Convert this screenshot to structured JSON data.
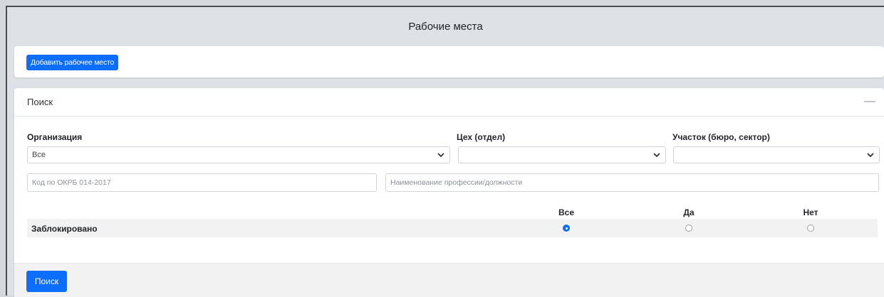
{
  "page": {
    "title": "Рабочие места"
  },
  "actions": {
    "add_button": "Добавить рабочее место"
  },
  "search": {
    "title": "Поиск",
    "collapse_icon": "minus-icon",
    "fields": {
      "organization": {
        "label": "Организация",
        "value": "Все"
      },
      "workshop": {
        "label": "Цех (отдел)",
        "value": ""
      },
      "section": {
        "label": "Участок (бюро, сектор)",
        "value": ""
      },
      "okrb_code": {
        "placeholder": "Код по ОКРБ 014-2017",
        "value": ""
      },
      "profession": {
        "placeholder": "Наименование профессии/должности",
        "value": ""
      }
    },
    "blocked": {
      "label": "Заблокировано",
      "options": [
        "Все",
        "Да",
        "Нет"
      ],
      "selected": "Все"
    },
    "submit_button": "Поиск"
  },
  "colors": {
    "primary": "#0d6efd",
    "page_background": "#dee2e6",
    "card_background": "#ffffff",
    "row_background": "#f2f2f2"
  }
}
